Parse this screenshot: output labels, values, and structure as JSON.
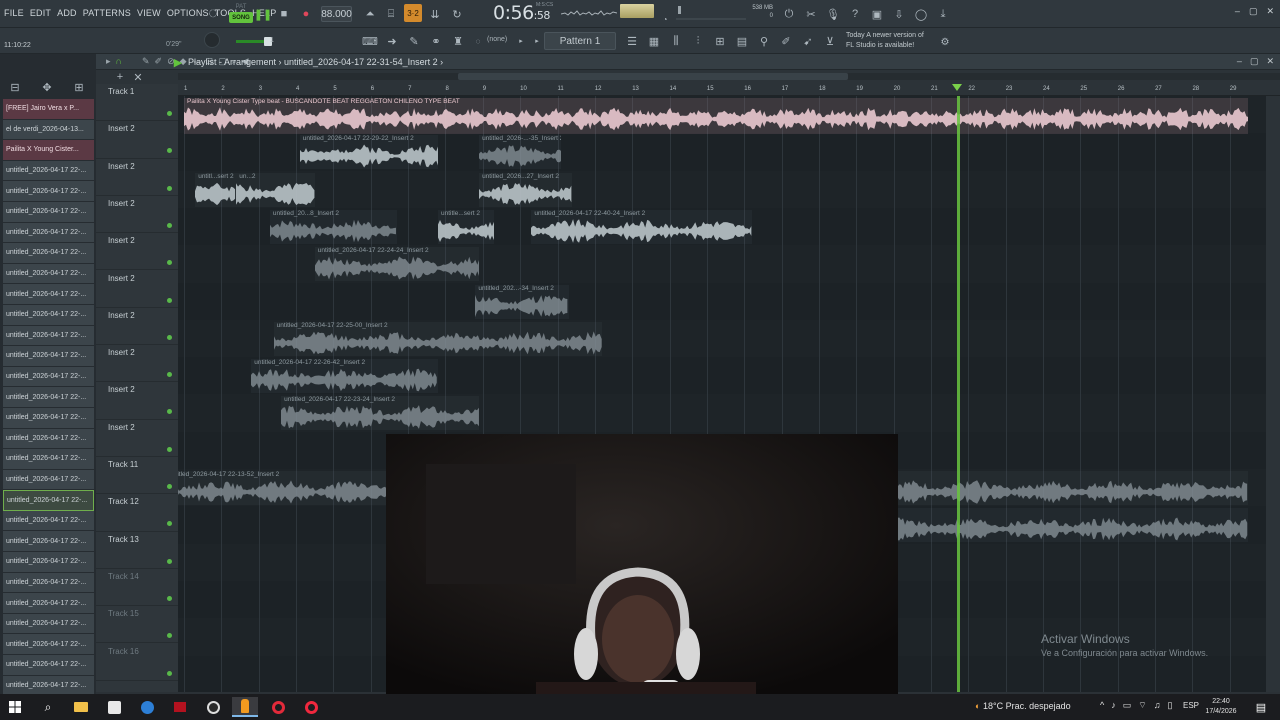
{
  "menu": [
    "FILE",
    "EDIT",
    "ADD",
    "PATTERNS",
    "VIEW",
    "OPTIONS",
    "TOOLS",
    "HELP"
  ],
  "transport": {
    "mode_song": "SONG",
    "mode_pat": "PAT",
    "bpm": "88.000",
    "time_main": "0:56",
    "time_sub": ":58",
    "time_label": "M:S:CS",
    "mem_line1": "538 MB",
    "mem_line2": "0"
  },
  "toolbar2": {
    "clock": "11:10:22",
    "small_time": "0'29\"",
    "vol_value": "1",
    "none_label": "(none)",
    "pattern": "Pattern 1",
    "news_line1": "Today  A newer version of",
    "news_line2": "FL Studio is available!"
  },
  "browser": {
    "items": [
      {
        "label": "[FREE] Jairo Vera x P...",
        "state": "hot"
      },
      {
        "label": "el de verdi_2026-04-13...",
        "state": "normal"
      },
      {
        "label": "Pailita X Young Cister...",
        "state": "hot"
      },
      {
        "label": "untitled_2026-04-17 22-...",
        "state": "normal"
      },
      {
        "label": "untitled_2026-04-17 22-...",
        "state": "normal"
      },
      {
        "label": "untitled_2026-04-17 22-...",
        "state": "normal"
      },
      {
        "label": "untitled_2026-04-17 22-...",
        "state": "normal"
      },
      {
        "label": "untitled_2026-04-17 22-...",
        "state": "normal"
      },
      {
        "label": "untitled_2026-04-17 22-...",
        "state": "normal"
      },
      {
        "label": "untitled_2026-04-17 22-...",
        "state": "normal"
      },
      {
        "label": "untitled_2026-04-17 22-...",
        "state": "normal"
      },
      {
        "label": "untitled_2026-04-17 22-...",
        "state": "normal"
      },
      {
        "label": "untitled_2026-04-17 22-...",
        "state": "normal"
      },
      {
        "label": "untitled_2026-04-17 22-...",
        "state": "normal"
      },
      {
        "label": "untitled_2026-04-17 22-...",
        "state": "normal"
      },
      {
        "label": "untitled_2026-04-17 22-...",
        "state": "normal"
      },
      {
        "label": "untitled_2026-04-17 22-...",
        "state": "normal"
      },
      {
        "label": "untitled_2026-04-17 22-...",
        "state": "normal"
      },
      {
        "label": "untitled_2026-04-17 22-...",
        "state": "normal"
      },
      {
        "label": "untitled_2026-04-17 22-...",
        "state": "sel"
      },
      {
        "label": "untitled_2026-04-17 22-...",
        "state": "normal"
      },
      {
        "label": "untitled_2026-04-17 22-...",
        "state": "normal"
      },
      {
        "label": "untitled_2026-04-17 22-...",
        "state": "normal"
      },
      {
        "label": "untitled_2026-04-17 22-...",
        "state": "normal"
      },
      {
        "label": "untitled_2026-04-17 22-...",
        "state": "normal"
      },
      {
        "label": "untitled_2026-04-17 22-...",
        "state": "normal"
      },
      {
        "label": "untitled_2026-04-17 22-...",
        "state": "normal"
      },
      {
        "label": "untitled_2026-04-17 22-...",
        "state": "normal"
      },
      {
        "label": "untitled_2026-04-17 22-...",
        "state": "normal"
      }
    ]
  },
  "playlist": {
    "title": "Playlist - Arrangement › untitled_2026-04-17 22-31-54_Insert 2 ›",
    "tracks": [
      {
        "name": "Track 1",
        "dim": false
      },
      {
        "name": "Insert 2",
        "dim": false
      },
      {
        "name": "Insert 2",
        "dim": false
      },
      {
        "name": "Insert 2",
        "dim": false
      },
      {
        "name": "Insert 2",
        "dim": false
      },
      {
        "name": "Insert 2",
        "dim": false
      },
      {
        "name": "Insert 2",
        "dim": false
      },
      {
        "name": "Insert 2",
        "dim": false
      },
      {
        "name": "Insert 2",
        "dim": false
      },
      {
        "name": "Insert 2",
        "dim": false
      },
      {
        "name": "Track 11",
        "dim": false
      },
      {
        "name": "Track 12",
        "dim": false
      },
      {
        "name": "Track 13",
        "dim": false
      },
      {
        "name": "Track 14",
        "dim": true
      },
      {
        "name": "Track 15",
        "dim": true
      },
      {
        "name": "Track 16",
        "dim": true
      }
    ],
    "ruler_bars": [
      "1",
      "2",
      "3",
      "4",
      "5",
      "6",
      "7",
      "8",
      "9",
      "10",
      "11",
      "12",
      "13",
      "14",
      "15",
      "16",
      "17",
      "18",
      "19",
      "20",
      "21",
      "22",
      "23",
      "24",
      "25",
      "26",
      "27",
      "28",
      "29"
    ],
    "clips": [
      {
        "label": "Pailita X Young Cister Type beat - BUSCANDOTE  BEAT REGGAETON CHILENO TYPE BEAT",
        "row": 0,
        "start": 1.0,
        "end": 29.5,
        "color": "pink"
      },
      {
        "label": "untitled_2026-04-17 22-29-22_Insert 2",
        "row": 1,
        "start": 4.1,
        "end": 7.8,
        "color": "normal"
      },
      {
        "label": "untitled_2026-...-35_Insert 2",
        "row": 1,
        "start": 8.9,
        "end": 11.1,
        "color": "dim"
      },
      {
        "label": "untitl...sert 2",
        "row": 2,
        "start": 1.3,
        "end": 2.4,
        "color": "normal"
      },
      {
        "label": "un...2",
        "row": 2,
        "start": 2.4,
        "end": 4.5,
        "color": "normal"
      },
      {
        "label": "untitled_2026...27_Insert 2",
        "row": 2,
        "start": 8.9,
        "end": 11.4,
        "color": "normal"
      },
      {
        "label": "untitled_20...8_Insert 2",
        "row": 3,
        "start": 3.3,
        "end": 6.7,
        "color": "dim"
      },
      {
        "label": "untitle...sert 2",
        "row": 3,
        "start": 7.8,
        "end": 9.3,
        "color": "normal"
      },
      {
        "label": "untitled_2026-04-17 22-40-24_Insert 2",
        "row": 3,
        "start": 10.3,
        "end": 16.2,
        "color": "normal"
      },
      {
        "label": "untitled_2026-04-17 22-24-24_Insert 2",
        "row": 4,
        "start": 4.5,
        "end": 8.9,
        "color": "dim"
      },
      {
        "label": "untitled_202...-34_Insert 2",
        "row": 5,
        "start": 8.8,
        "end": 11.3,
        "color": "dim"
      },
      {
        "label": "untitled_2026-04-17 22-25-00_Insert 2",
        "row": 6,
        "start": 3.4,
        "end": 12.2,
        "color": "dim"
      },
      {
        "label": "untitled_2026-04-17 22-26-42_Insert 2",
        "row": 7,
        "start": 2.8,
        "end": 7.8,
        "color": "dim"
      },
      {
        "label": "untitled_2026-04-17 22-23-24_Insert 2",
        "row": 8,
        "start": 3.6,
        "end": 8.9,
        "color": "dim"
      },
      {
        "label": "untitled_2026-04-17 22-13-52_Insert 2",
        "row": 10,
        "start": 0.5,
        "end": 29.5,
        "color": "dim"
      },
      {
        "label": "",
        "row": 11,
        "start": 19.4,
        "end": 29.5,
        "color": "dim"
      }
    ],
    "playhead_bar": 21.7
  },
  "webcam": {
    "visible": true
  },
  "watermark": {
    "line1": "Activar Windows",
    "line2": "Ve a Configuración para activar Windows."
  },
  "taskbar": {
    "weather": "18°C  Prac. despejado",
    "lang": "ESP",
    "time": "22:40",
    "date": "17/4/2026"
  },
  "colors": {
    "accent_green": "#68c43f",
    "song_green": "#62c33d",
    "hot_item": "#5b3944"
  }
}
